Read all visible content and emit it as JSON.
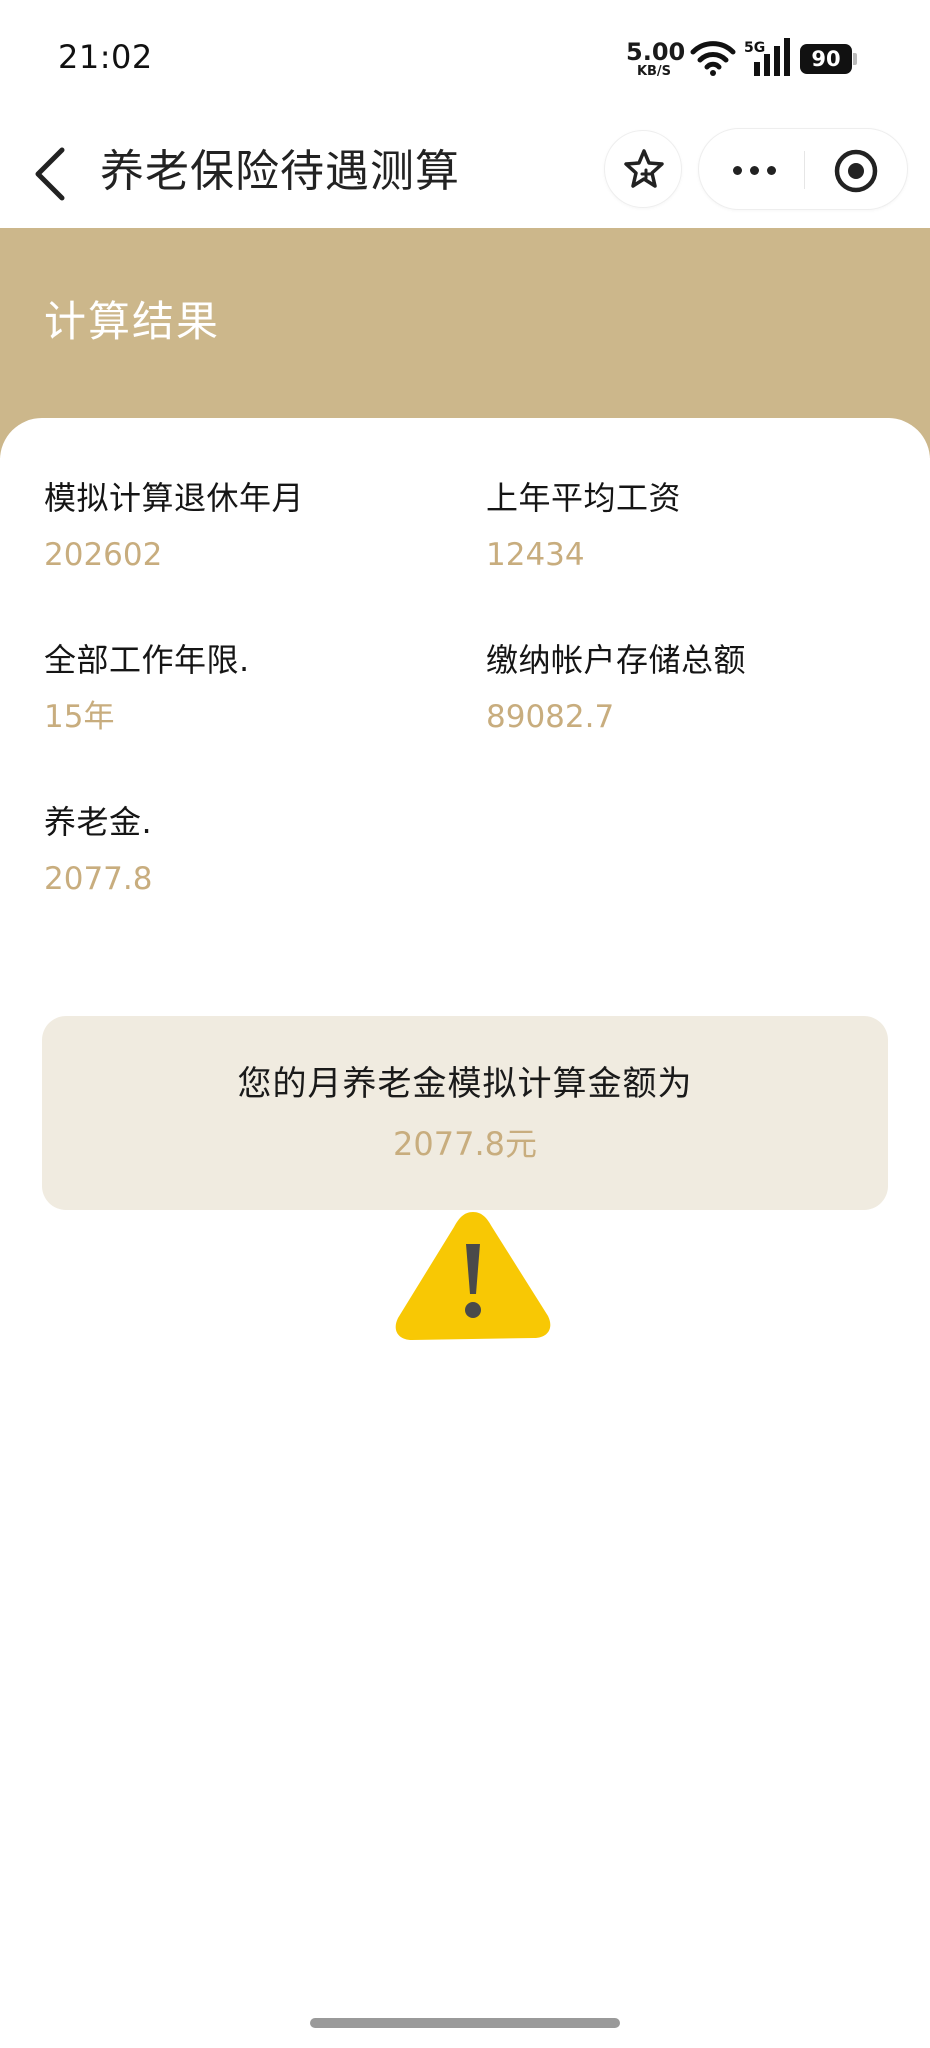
{
  "status_bar": {
    "time": "21:02",
    "net_speed_value": "5.00",
    "net_speed_unit": "KB/S",
    "network_type": "5G",
    "battery": "90",
    "icons": [
      "wifi-icon",
      "signal-icon",
      "battery-icon"
    ]
  },
  "nav": {
    "title": "养老保险待遇测算",
    "icons": [
      "back-arrow-icon",
      "star-icon",
      "more-dots-icon",
      "target-icon"
    ]
  },
  "result": {
    "section_title": "计算结果",
    "fields": [
      {
        "label": "模拟计算退休年月",
        "value": "202602"
      },
      {
        "label": "上年平均工资",
        "value": "12434"
      },
      {
        "label": "全部工作年限.",
        "value": "15年"
      },
      {
        "label": "缴纳帐户存储总额",
        "value": "89082.7"
      },
      {
        "label": "养老金.",
        "value": "2077.8"
      }
    ],
    "summary_label": "您的月养老金模拟计算金额为",
    "summary_value": "2077.8元"
  },
  "colors": {
    "accent_gold": "#ccb78b",
    "value_gold": "#c8ad7e",
    "summary_bg": "#f0ebe0",
    "warning_yellow": "#f8c804"
  },
  "overlay": {
    "icon": "warning-triangle-icon"
  }
}
